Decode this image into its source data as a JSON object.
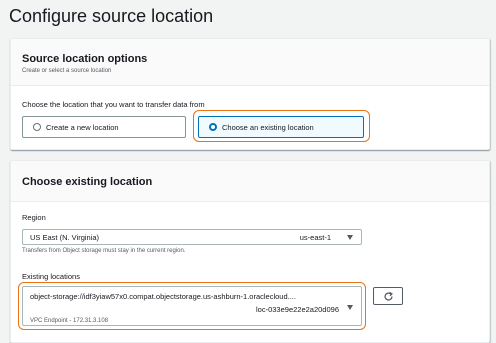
{
  "page": {
    "title": "Configure source location"
  },
  "source_options": {
    "title": "Source location options",
    "description": "Create or select a source location",
    "question": "Choose the location that you want to transfer data from",
    "options": [
      {
        "label": "Create a new location",
        "selected": false
      },
      {
        "label": "Choose an existing location",
        "selected": true
      }
    ]
  },
  "existing_location": {
    "title": "Choose existing location",
    "region": {
      "label": "Region",
      "value": "US East (N. Virginia)",
      "code": "us-east-1",
      "hint": "Transfers from Object storage must stay in the current region."
    },
    "locations": {
      "label": "Existing locations",
      "uri": "object-storage://idf3yiaw57x0.compat.objectstorage.us-ashburn-1.oraclecloud....",
      "id": "loc-033e9e22e2a20d096",
      "vpc": "VPC Endpoint - 172.31.3.108"
    }
  },
  "colors": {
    "accent": "#0073bb",
    "highlight": "#ec7211",
    "background": "#f2f3f3"
  },
  "icons": {
    "refresh": "refresh-icon",
    "dropdown": "caret-down-icon"
  }
}
